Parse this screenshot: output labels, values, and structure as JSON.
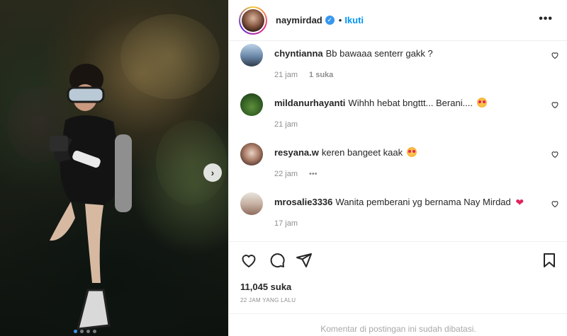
{
  "post": {
    "username": "naymirdad",
    "separator": "•",
    "follow_label": "Ikuti",
    "more_icon": "more-options-icon",
    "verified_icon": "verified-badge-icon",
    "next_icon": "chevron-right-icon"
  },
  "comments": [
    {
      "user": "chyntianna",
      "text": "Bb bawaaa senterr gakk ?",
      "time": "21 jam",
      "likes": "1 suka",
      "emoji": ""
    },
    {
      "user": "mildanurhayanti",
      "text": "Wihhh hebat bngttt... Berani....",
      "time": "21 jam",
      "likes": "",
      "emoji": "star-struck"
    },
    {
      "user": "resyana.w",
      "text": "keren bangeet kaak",
      "time": "22 jam",
      "likes": "",
      "options": "•••",
      "emoji": "star-struck"
    },
    {
      "user": "mrosalie3336",
      "text": "Wanita pemberani yg bernama Nay Mirdad",
      "time": "17 jam",
      "likes": "",
      "emoji": "red-heart"
    }
  ],
  "actions": {
    "like_count": "11,045 suka",
    "post_time": "22 JAM YANG LALU",
    "comments_closed": "Komentar di postingan ini sudah dibatasi."
  },
  "colors": {
    "accent": "#0095f6",
    "muted": "#8e8e8e",
    "border": "#efefef"
  }
}
